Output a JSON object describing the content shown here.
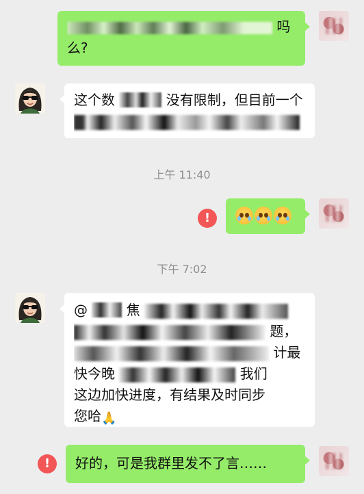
{
  "messages": [
    {
      "side": "right",
      "text_tail": "吗",
      "text_line2": "么?"
    },
    {
      "side": "left",
      "line1_start": "这个数",
      "line1_mid": "没有限制，但目前一个"
    },
    {
      "side": "right",
      "emoji": [
        "crying-face",
        "crying-face",
        "crying-face"
      ],
      "failed": true
    },
    {
      "side": "left",
      "mention": "@",
      "mention_name": "焦",
      "line2_tail": "题，",
      "line3_tail": "计最",
      "line4": "快今晚",
      "line4_tail": "我们",
      "line5": "这边加快进度，有结果及时同步",
      "line6": "您哈"
    },
    {
      "side": "right",
      "text": "好的，可是我群里发不了言……",
      "failed": true
    }
  ],
  "timestamps": {
    "first": "上午 11:40",
    "second": "下午 7:02"
  },
  "error_symbol": "!",
  "colors": {
    "background": "#ededed",
    "bubble_self": "#95ec69",
    "bubble_other": "#ffffff",
    "error": "#f35656",
    "timestamp": "#8e8e8e"
  }
}
